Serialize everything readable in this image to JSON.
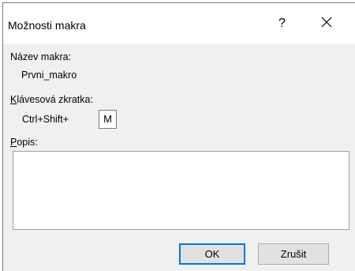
{
  "dialog": {
    "title": "Možnosti makra",
    "help_label": "?",
    "close_icon": "close-icon"
  },
  "macro_name": {
    "label": "Název makra:",
    "value": "Prvni_makro"
  },
  "shortcut": {
    "label_underlined": "K",
    "label_rest": "lávesová zkratka:",
    "prefix": "Ctrl+Shift+",
    "key": "M"
  },
  "description": {
    "label_underlined": "P",
    "label_rest": "opis:",
    "value": ""
  },
  "buttons": {
    "ok": "OK",
    "cancel": "Zrušit"
  }
}
